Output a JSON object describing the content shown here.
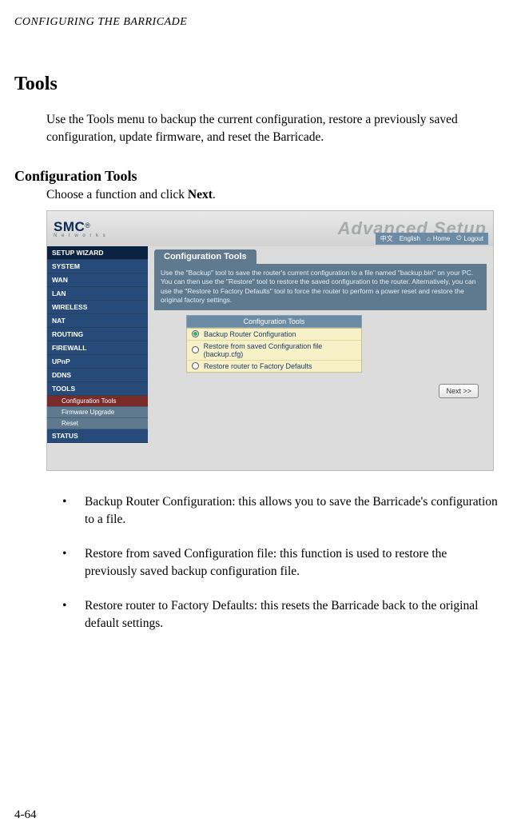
{
  "runningHead": "CONFIGURING THE BARRICADE",
  "sectionTitle": "Tools",
  "intro": "Use the Tools menu to backup the current configuration, restore a previously saved configuration, update firmware, and reset the Barricade.",
  "subsectionTitle": "Configuration Tools",
  "subPrefix": "Choose a function and click ",
  "subBold": "Next",
  "subSuffix": ".",
  "screenshot": {
    "logoText": "SMC",
    "logoSub": "N e t w o r k s",
    "advanced": "Advanced Setup",
    "langCn": "中文",
    "langEn": "English",
    "home": "Home",
    "logout": "Logout",
    "nav": {
      "setup": "SETUP WIZARD",
      "system": "SYSTEM",
      "wan": "WAN",
      "lan": "LAN",
      "wireless": "WIRELESS",
      "nat": "NAT",
      "routing": "ROUTING",
      "firewall": "FIREWALL",
      "upnp": "UPnP",
      "ddns": "DDNS",
      "tools": "TOOLS",
      "sub1": "Configuration Tools",
      "sub2": "Firmware Upgrade",
      "sub3": "Reset",
      "status": "STATUS"
    },
    "panelTitle": "Configuration Tools",
    "panelDesc": "Use the \"Backup\" tool to save the router's current configuration to a file named \"backup.bin\" on your PC. You can then use the \"Restore\" tool to restore the saved configuration to the router. Alternatively, you can use the \"Restore to Factory Defaults\" tool to force the router to perform a power reset and restore the original factory settings.",
    "toolsHeader": "Configuration Tools",
    "opt1": "Backup Router Configuration",
    "opt2": "Restore from saved Configuration file (backup.cfg)",
    "opt3": "Restore router to Factory Defaults",
    "nextBtn": "Next >>"
  },
  "bullets": {
    "b1": "Backup Router Configuration: this allows you to save the Barricade's configuration to a file.",
    "b2": "Restore from saved Configuration file: this function is used to restore the previously saved backup configuration file.",
    "b3": "Restore router to Factory Defaults: this resets the Barricade back to the original default settings."
  },
  "pageNum": "4-64"
}
